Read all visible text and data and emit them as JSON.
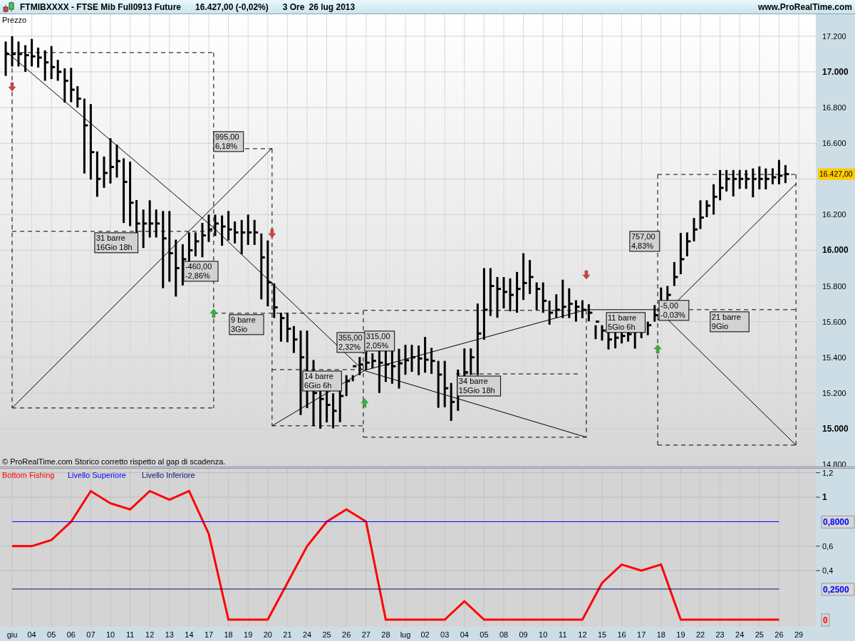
{
  "title_bar": {
    "symbol": "FTMIBXXXX - FTSE Mib Full0913 Future",
    "price": "16.427,00 (-0,02%)",
    "timeframe": "3 Ore",
    "date": "26 lug 2013",
    "website": "www.ProRealTime.com"
  },
  "price_panel": {
    "label": "Prezzo",
    "footnote": "© ProRealTime.com  Storico corretto rispetto al gap di scadenza.",
    "last_price_tag": "16.427,00",
    "y_axis_labels": [
      {
        "text": "17.200",
        "major": false
      },
      {
        "text": "17.000",
        "major": true
      },
      {
        "text": "16.800",
        "major": false
      },
      {
        "text": "16.600",
        "major": false
      },
      {
        "text": "16.200",
        "major": false
      },
      {
        "text": "16.000",
        "major": true
      },
      {
        "text": "15.800",
        "major": false
      },
      {
        "text": "15.600",
        "major": false
      },
      {
        "text": "15.400",
        "major": false
      },
      {
        "text": "15.200",
        "major": false
      },
      {
        "text": "15.000",
        "major": true
      },
      {
        "text": "14.800",
        "major": false
      }
    ],
    "measure_labels": [
      {
        "text": [
          "995,00",
          "6,18%"
        ]
      },
      {
        "text": [
          "31 barre",
          "16Gio 18h"
        ]
      },
      {
        "text": [
          "-460,00",
          "-2,86%"
        ]
      },
      {
        "text": [
          "9 barre",
          "3Gio"
        ]
      },
      {
        "text": [
          "355,00",
          "2,32%"
        ]
      },
      {
        "text": [
          "315,00",
          "2,05%"
        ]
      },
      {
        "text": [
          "14 barre",
          "6Gio 6h"
        ]
      },
      {
        "text": [
          "34 barre",
          "15Gio 18h"
        ]
      },
      {
        "text": [
          "757,00",
          "4,83%"
        ]
      },
      {
        "text": [
          "11 barre",
          "5Gio 6h"
        ]
      },
      {
        "text": [
          "-5,00",
          "-0,03%"
        ]
      },
      {
        "text": [
          "21 barre",
          "9Gio"
        ]
      }
    ]
  },
  "indicator_panel": {
    "chart_data": {
      "type": "line",
      "categories": [
        "giu",
        "04",
        "05",
        "06",
        "07",
        "10",
        "11",
        "12",
        "13",
        "14",
        "17",
        "18",
        "19",
        "20",
        "21",
        "24",
        "25",
        "26",
        "27",
        "28",
        "lug",
        "02",
        "03",
        "04",
        "05",
        "08",
        "09",
        "10",
        "11",
        "12",
        "15",
        "16",
        "17",
        "18",
        "19",
        "22",
        "23",
        "24",
        "25",
        "26",
        "29"
      ],
      "series": [
        {
          "name": "Bottom Fishing",
          "color": "#ff0000",
          "values": [
            0.6,
            0.6,
            0.65,
            0.8,
            1.05,
            0.95,
            0.9,
            1.05,
            0.98,
            1.05,
            0.7,
            0,
            0,
            0,
            0.3,
            0.6,
            0.8,
            0.9,
            0.8,
            0,
            0,
            0,
            0,
            0.15,
            0,
            0,
            0,
            0,
            0,
            0,
            0.3,
            0.45,
            0.4,
            0.45,
            0,
            0,
            0,
            0,
            0,
            0,
            null
          ]
        },
        {
          "name": "Livello Superiore",
          "color": "#0000ff",
          "values": [
            0.8,
            0.8,
            0.8,
            0.8,
            0.8,
            0.8,
            0.8,
            0.8,
            0.8,
            0.8,
            0.8,
            0.8,
            0.8,
            0.8,
            0.8,
            0.8,
            0.8,
            0.8,
            0.8,
            0.8,
            0.8,
            0.8,
            0.8,
            0.8,
            0.8,
            0.8,
            0.8,
            0.8,
            0.8,
            0.8,
            0.8,
            0.8,
            0.8,
            0.8,
            0.8,
            0.8,
            0.8,
            0.8,
            0.8,
            0.8,
            null
          ]
        },
        {
          "name": "Livello Inferiore",
          "color": "#10107a",
          "values": [
            0.25,
            0.25,
            0.25,
            0.25,
            0.25,
            0.25,
            0.25,
            0.25,
            0.25,
            0.25,
            0.25,
            0.25,
            0.25,
            0.25,
            0.25,
            0.25,
            0.25,
            0.25,
            0.25,
            0.25,
            0.25,
            0.25,
            0.25,
            0.25,
            0.25,
            0.25,
            0.25,
            0.25,
            0.25,
            0.25,
            0.25,
            0.25,
            0.25,
            0.25,
            0.25,
            0.25,
            0.25,
            0.25,
            0.25,
            0.25,
            null
          ]
        }
      ],
      "ylim": [
        -0.058,
        1.233
      ],
      "grid": true,
      "yticks": [
        {
          "value": 1.2,
          "label": "1,2"
        },
        {
          "value": 1,
          "label": "1"
        },
        {
          "value": 0.6,
          "label": "0,6"
        },
        {
          "value": 0.4,
          "label": "0,4"
        }
      ]
    },
    "axis_badges": [
      {
        "text": "0,8000",
        "color": "#0000ff"
      },
      {
        "text": "0,2500",
        "color": "#0000ff"
      },
      {
        "text": "0",
        "color": "#ff0000"
      }
    ]
  }
}
